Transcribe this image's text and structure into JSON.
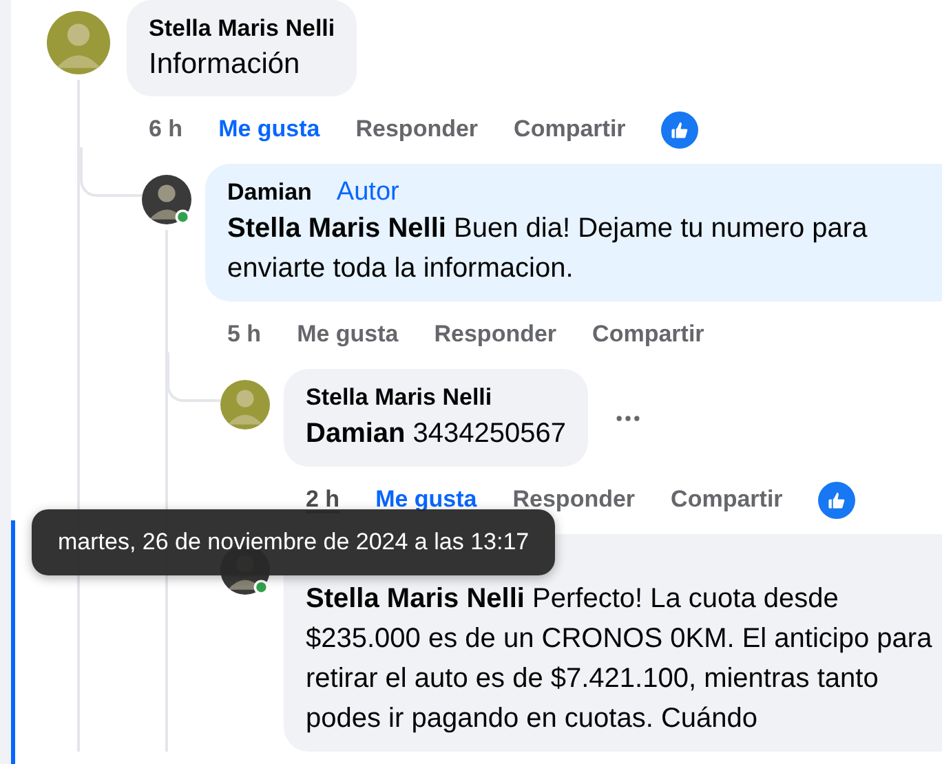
{
  "comments": [
    {
      "author": "Stella Maris Nelli",
      "large_text": true,
      "text": "Información",
      "time": "6 h",
      "time_hovered": false,
      "like": "Me gusta",
      "liked": true,
      "reply": "Responder",
      "share": "Compartir",
      "has_reaction": true,
      "replies": [
        {
          "author": "Damian",
          "badge": "Autor",
          "online": true,
          "mention": "Stella Maris Nelli",
          "text": "Buen dia! Dejame tu numero para enviarte toda la informacion.",
          "time": "5 h",
          "time_hovered": false,
          "like": "Me gusta",
          "liked": false,
          "reply": "Responder",
          "share": "Compartir",
          "replies": [
            {
              "author": "Stella Maris Nelli",
              "online": false,
              "mention": "Damian",
              "text": "3434250567",
              "time": "2 h",
              "time_hovered": true,
              "like": "Me gusta",
              "liked": true,
              "reply": "Responder",
              "share": "Compartir",
              "has_more_menu": true
            },
            {
              "online": true,
              "mention": "Stella Maris Nelli",
              "text": "Perfecto! La cuota desde $235.000 es de un CRONOS 0KM. El anticipo para retirar el auto es de $7.421.100, mientras tanto podes ir pagando en cuotas. Cuándo",
              "has_more_menu": false
            }
          ]
        }
      ]
    }
  ],
  "tooltip": {
    "text": "martes, 26 de noviembre de 2024 a las 13:17"
  }
}
